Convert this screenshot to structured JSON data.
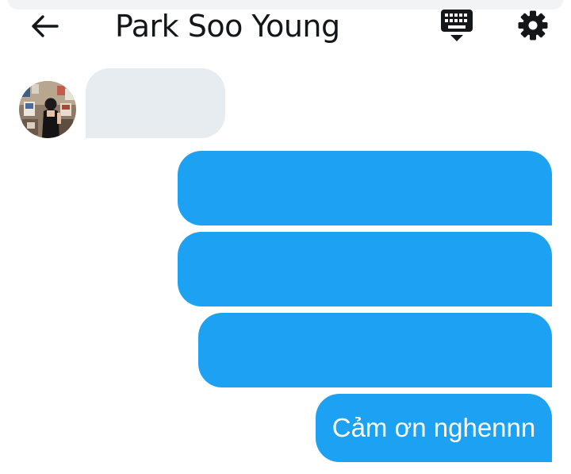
{
  "header": {
    "title": "Park Soo Young",
    "back_icon": "arrow-left-icon",
    "keyboard_icon": "keyboard-icon",
    "settings_icon": "gear-icon"
  },
  "conversation": {
    "contact_avatar": "avatar",
    "messages": [
      {
        "direction": "incoming",
        "text": ""
      },
      {
        "direction": "outgoing",
        "text": ""
      },
      {
        "direction": "outgoing",
        "text": ""
      },
      {
        "direction": "outgoing",
        "text": ""
      },
      {
        "direction": "outgoing",
        "text": "Cảm ơn nghennn"
      }
    ]
  },
  "colors": {
    "outgoing_bubble": "#1da1f2",
    "incoming_bubble": "#e6ecf0",
    "title_text": "#14171a",
    "icon": "#14171a"
  }
}
